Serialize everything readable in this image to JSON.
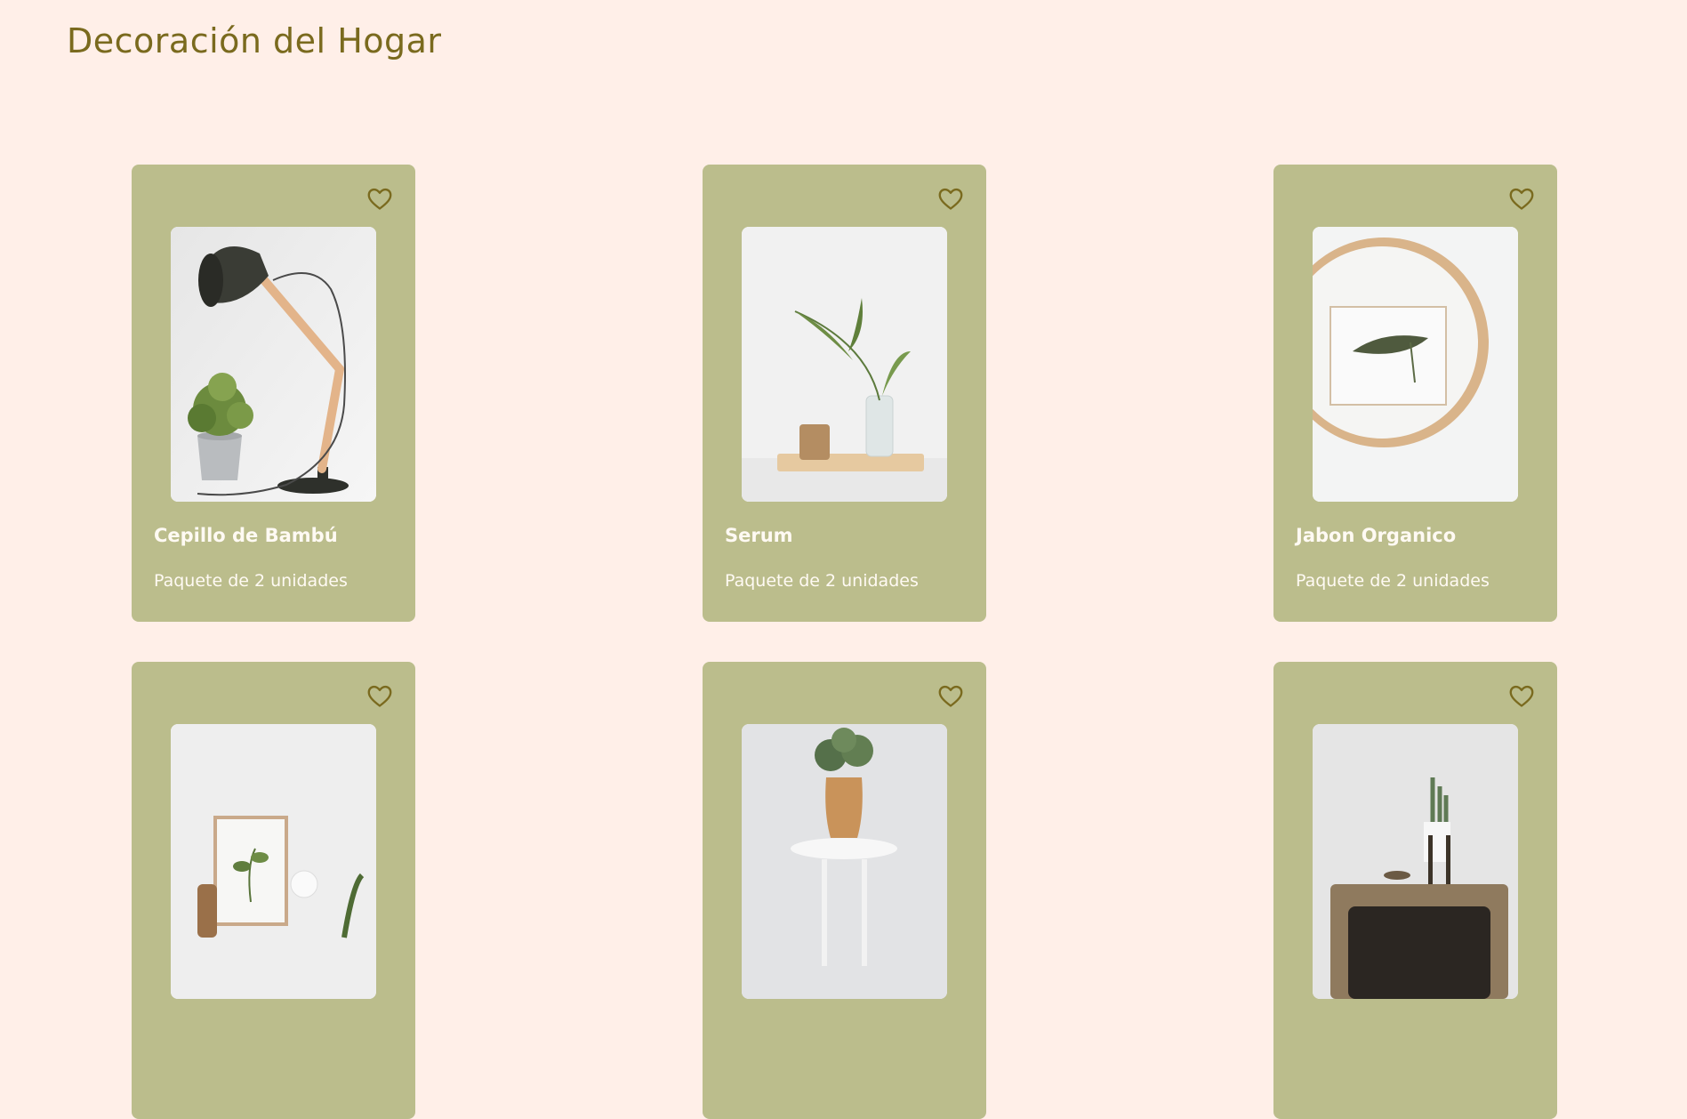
{
  "header": {
    "title": "Decoración del Hogar"
  },
  "colors": {
    "background": "#ffefe8",
    "card": "#bbbd8c",
    "accent": "#7a6a1e",
    "card_text": "#fffaf3"
  },
  "products": [
    {
      "title": "Cepillo de Bambú",
      "subtitle": "Paquete de 2 unidades",
      "image": "desk-lamp-with-plant",
      "icon": "heart-outline-icon"
    },
    {
      "title": "Serum",
      "subtitle": "Paquete de 2 unidades",
      "image": "plant-vase-on-tray",
      "icon": "heart-outline-icon"
    },
    {
      "title": "Jabon Organico",
      "subtitle": "Paquete de 2 unidades",
      "image": "round-wood-mirror-leaf",
      "icon": "heart-outline-icon"
    },
    {
      "title": "",
      "subtitle": "",
      "image": "framed-plant-shelf",
      "icon": "heart-outline-icon"
    },
    {
      "title": "",
      "subtitle": "",
      "image": "wood-vase-on-stool",
      "icon": "heart-outline-icon"
    },
    {
      "title": "",
      "subtitle": "",
      "image": "cactus-on-wood-cabinet",
      "icon": "heart-outline-icon"
    }
  ]
}
